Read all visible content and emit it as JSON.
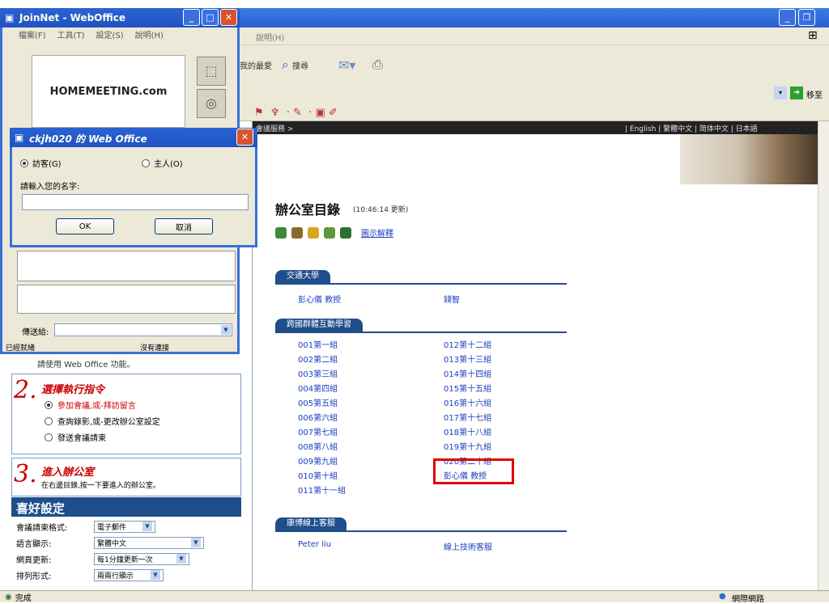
{
  "browser": {
    "menu_help": "說明(H)",
    "toolbar": {
      "favorites": "我的最愛",
      "search": "搜尋"
    },
    "address": {
      "go": "移至"
    },
    "page_header": {
      "breadcrumb": "會議服務 >",
      "langs": "| English | 繁體中文 | 简体中文 | 日本語"
    },
    "status_left": "完成",
    "status_right": "網際網路"
  },
  "left_panel": {
    "step1_note": "請使用 Web Office 功能。",
    "step2": {
      "num": "2.",
      "title": "選擇執行指令",
      "options": [
        "參加會議,或-拜訪留言",
        "查詢錄影,或-更改辦公室設定",
        "發送會議請柬"
      ]
    },
    "step3": {
      "num": "3.",
      "title": "進入辦公室",
      "desc": "在右邊目錄,按一下要進入的辦公室。"
    },
    "preferences": {
      "header": "喜好設定",
      "rows": [
        {
          "label": "會議請柬格式:",
          "value": "電子郵件"
        },
        {
          "label": "語言顯示:",
          "value": "繁體中文"
        },
        {
          "label": "網頁更新:",
          "value": "每1分鐘更新一次"
        },
        {
          "label": "排列形式:",
          "value": "兩兩行顯示"
        }
      ]
    }
  },
  "content": {
    "title": "辦公室目錄",
    "updated": "(10:46:14 更新)",
    "help_link": "圖示解釋",
    "groups": [
      {
        "name": "交通大學",
        "links_left": [
          "彭心儀 教授"
        ],
        "links_right": [
          "錢智"
        ]
      },
      {
        "name": "跨國群體互動學習",
        "links_left": [
          "001第一組",
          "002第二組",
          "003第三組",
          "004第四組",
          "005第五組",
          "006第六組",
          "007第七組",
          "008第八組",
          "009第九組",
          "010第十組",
          "011第十一組"
        ],
        "links_right": [
          "012第十二組",
          "013第十三組",
          "014第十四組",
          "015第十五組",
          "016第十六組",
          "017第十七組",
          "018第十八組",
          "019第十九組",
          "020第二十組",
          "彭心儀 教授"
        ]
      },
      {
        "name": "康博線上客服",
        "links_left": [
          "Peter liu"
        ],
        "links_right": [
          "線上技術客服"
        ]
      }
    ]
  },
  "joinnet_window": {
    "title": "JoinNet - WebOffice",
    "menu": [
      "檔案(F)",
      "工具(T)",
      "設定(S)",
      "說明(H)"
    ],
    "logo": "HOMEMEETING.com",
    "send_to_label": "傳送給:",
    "status_left": "已經就緒",
    "status_right": "沒有連接"
  },
  "login_dialog": {
    "title": "ckjh020 的 Web Office",
    "radio_guest": "訪客(G)",
    "radio_owner": "主人(O)",
    "prompt": "請輸入您的名字:",
    "name_value": "",
    "ok": "OK",
    "cancel": "取消"
  }
}
